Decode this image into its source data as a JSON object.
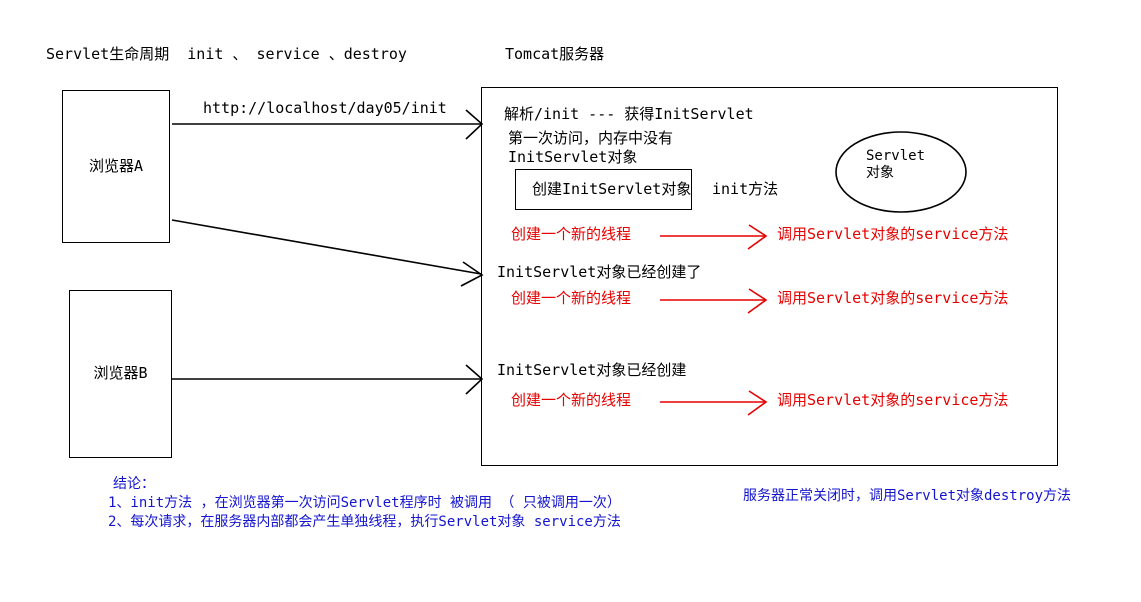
{
  "diagram": {
    "title_left": "Servlet生命周期  init 、 service 、destroy",
    "title_right": "Tomcat服务器"
  },
  "browsers": [
    {
      "label": "浏览器A"
    },
    {
      "label": "浏览器B"
    }
  ],
  "requests": [
    {
      "label": "http://localhost/day05/init"
    }
  ],
  "server": {
    "line_parse": "解析/init --- 获得InitServlet",
    "line_first_visit_1": "第一次访问，内存中没有",
    "line_first_visit_2": "InitServlet对象",
    "create_box_label": "创建InitServlet对象",
    "init_method_label": "init方法",
    "servlet_object": {
      "line1": "Servlet",
      "line2": "对象"
    },
    "already_created_1": "InitServlet对象已经创建了",
    "already_created_2": "InitServlet对象已经创建"
  },
  "threads": [
    {
      "left": "创建一个新的线程",
      "right": "调用Servlet对象的service方法"
    },
    {
      "left": "创建一个新的线程",
      "right": "调用Servlet对象的service方法"
    },
    {
      "left": "创建一个新的线程",
      "right": "调用Servlet对象的service方法"
    }
  ],
  "conclusion": {
    "heading": "结论：",
    "item1": "1、init方法 ，在浏览器第一次访问Servlet程序时 被调用 （ 只被调用一次）",
    "item2": "2、每次请求，在服务器内部都会产生单独线程，执行Servlet对象 service方法"
  },
  "destroy_note": {
    "text": "服务器正常关闭时，调用Servlet对象destroy方法"
  },
  "colors": {
    "black": "#000000",
    "red": "#e60000",
    "blue": "#1414cf"
  }
}
